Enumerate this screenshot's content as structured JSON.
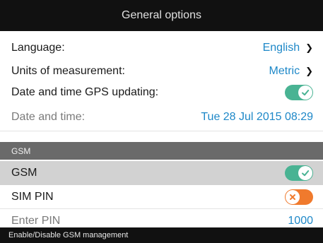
{
  "header": {
    "title": "General options"
  },
  "general": {
    "language_label": "Language:",
    "language_value": "English",
    "units_label": "Units of measurement:",
    "units_value": "Metric",
    "gps_update_label": "Date and time GPS updating:",
    "gps_update_state": "on",
    "datetime_label": "Date and time:",
    "datetime_value": "Tue 28 Jul 2015 08:29"
  },
  "gsm_section": {
    "header": "GSM",
    "gsm_label": "GSM",
    "gsm_state": "on",
    "sim_pin_label": "SIM PIN",
    "sim_pin_state": "off",
    "enter_pin_label": "Enter PIN",
    "enter_pin_value": "1000"
  },
  "status_bar": {
    "text": "Enable/Disable GSM management"
  },
  "icons": {
    "chevron": "chevron-right-icon",
    "toggle_on": "check-icon",
    "toggle_off": "x-icon"
  },
  "colors": {
    "accent_value": "#1e88c8",
    "toggle_on": "#49b393",
    "toggle_off": "#f07a2d",
    "header_bg": "#111111",
    "section_bg": "#6a6a6a",
    "highlight_row": "#d2d2d2"
  }
}
